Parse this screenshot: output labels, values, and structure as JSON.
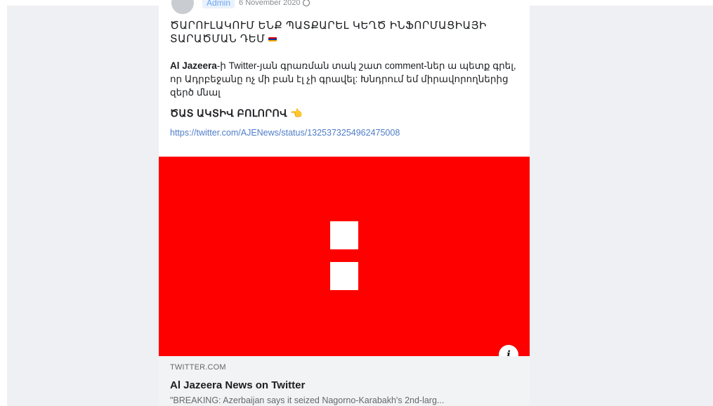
{
  "post": {
    "author": "Admin",
    "date": "6 November 2020",
    "headline": "ԾԱՐՈՒԼԱԿՈՒՄ ԵՆՔ ՊԱՏՔԱՐԵԼ ԿԵՂԾ ԻՆՖՈՐՄԱՑԻԱՅԻ ՏԱՐԱԾՄԱՆ ԴԵՄ",
    "body_prefix": "Al Jazeera",
    "body_text": "-ի Twitter-յան գրառման տակ շատ comment-ներ ա պետք գրել, որ Ադրբեջանը ոչ մի բան էլ չի գրավել: Խնդրում եմ միրավորողներից զերծ մնալ",
    "cta": "ԾԱՏ ԱԿՏԻՎ ԲՈԼՈՐՈՎ",
    "link": "https://twitter.com/AJENews/status/1325373254962475008"
  },
  "preview": {
    "domain": "TWITTER.COM",
    "title": "Al Jazeera News on Twitter",
    "description": "\"BREAKING: Azerbaijan says it seized Nagorno-Karabakh's 2nd-larg..."
  },
  "icons": {
    "info": "i",
    "hand": "👈"
  },
  "colors": {
    "media_background": "#ff0000",
    "link": "#4f7dc9"
  }
}
